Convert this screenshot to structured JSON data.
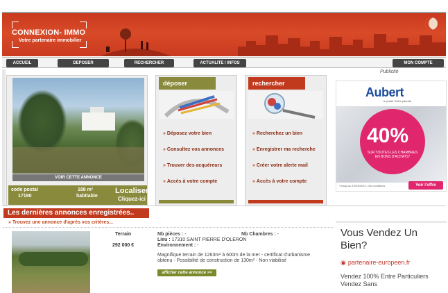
{
  "header": {
    "logo_title": "CONNEXION- IMMO",
    "logo_subtitle": "Votre partenaire immobilier",
    "banner_color": "#c93b20"
  },
  "nav": {
    "items": [
      {
        "label": "ACCUEIL"
      },
      {
        "label": "DEPOSER"
      },
      {
        "label": "RECHERCHER"
      },
      {
        "label": "ACTUALITE / INFOS"
      },
      {
        "label": "MON COMPTE"
      }
    ]
  },
  "featured": {
    "see_label": "VOIR CETTE ANNONCE",
    "postal_label": "code postal",
    "postal_value": "17190",
    "area": "188 m²",
    "area_label": "habitable",
    "localise_1": "Localiser",
    "localise_2": "Cliquez-ici"
  },
  "deposer": {
    "title": "déposer",
    "color": "#8a8a3d",
    "items": [
      "Déposez votre bien",
      "Consultez vos annonces",
      "Trouver des acquéreurs",
      "Accès à votre compte"
    ]
  },
  "rechercher": {
    "title": "rechercher",
    "color": "#c13a1e",
    "items": [
      "Recherchez un bien",
      "Enregistrer ma recherche",
      "Créer votre alerte mail",
      "Accès à votre compte"
    ]
  },
  "ads": {
    "label": "Publicité",
    "aubert": {
      "brand": "Aubert",
      "tagline": "le plaisir d'être parents",
      "percent": "40%",
      "promo": "SUR TOUTES LES CHAMBRES EN BONS D'ACHATS*",
      "fine_print": "*Jusqu'au 19/04/2014, voir conditions",
      "cta": "Voir l'offre",
      "accent": "#e0266c"
    },
    "vendez": {
      "headline": "Vous Vendez Un Bien?",
      "site": "partenaire-europeen.fr",
      "body": "Vendez 100% Entre Particuliers Vendez Sans"
    }
  },
  "listings": {
    "section_title": "Les dernières annonces enregistrées..",
    "search_link": "Trouvez une annonce d'après vos critères...",
    "items": [
      {
        "type": "Terrain",
        "price": "292 000 €",
        "rooms_label": "Nb pièces :",
        "rooms_value": "-",
        "bedrooms_label": "Nb Chambres :",
        "bedrooms_value": "-",
        "location_label": "Lieu :",
        "location_value": "17310 SAINT PIERRE D'OLERON",
        "env_label": "Environnement :",
        "env_value": "-",
        "description": "Magnifique terrain de 1263m² à 600m de la mer - certificat d'urbanisme obtenu - Possibilité de construction de 130m² - Non viabilisé",
        "button": "afficher cette annonce >>"
      }
    ]
  }
}
